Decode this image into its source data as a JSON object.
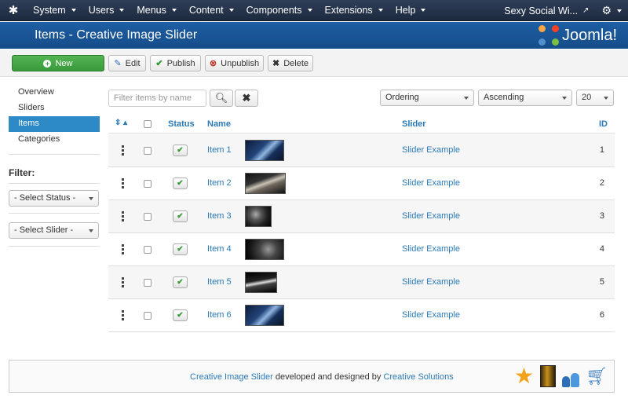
{
  "navbar": {
    "items": [
      "System",
      "Users",
      "Menus",
      "Content",
      "Components",
      "Extensions",
      "Help"
    ],
    "site_link": "Sexy Social Wi..."
  },
  "header": {
    "title": "Items - Creative Image Slider",
    "logo_text": "Joomla!"
  },
  "toolbar": {
    "new": "New",
    "edit": "Edit",
    "publish": "Publish",
    "unpublish": "Unpublish",
    "delete": "Delete"
  },
  "sidebar": {
    "items": [
      "Overview",
      "Sliders",
      "Items",
      "Categories"
    ],
    "active": "Items",
    "filter_label": "Filter:",
    "select_status": "- Select Status -",
    "select_slider": "- Select Slider -"
  },
  "filters": {
    "search_placeholder": "Filter items by name",
    "ordering": "Ordering",
    "direction": "Ascending",
    "limit": "20"
  },
  "table": {
    "headers": {
      "status": "Status",
      "name": "Name",
      "slider": "Slider",
      "id": "ID"
    },
    "rows": [
      {
        "name": "Item 1",
        "slider": "Slider Example",
        "id": "1"
      },
      {
        "name": "Item 2",
        "slider": "Slider Example",
        "id": "2"
      },
      {
        "name": "Item 3",
        "slider": "Slider Example",
        "id": "3"
      },
      {
        "name": "Item 4",
        "slider": "Slider Example",
        "id": "4"
      },
      {
        "name": "Item 5",
        "slider": "Slider Example",
        "id": "5"
      },
      {
        "name": "Item 6",
        "slider": "Slider Example",
        "id": "6"
      }
    ]
  },
  "footer": {
    "product": "Creative Image Slider",
    "middle": " developed and designed by ",
    "company": "Creative Solutions"
  },
  "colors": {
    "navbar": "#1c2a3f",
    "header": "#1a5596",
    "active": "#2d8ac7",
    "link": "#2a7ab8",
    "new_button": "#45a845"
  }
}
